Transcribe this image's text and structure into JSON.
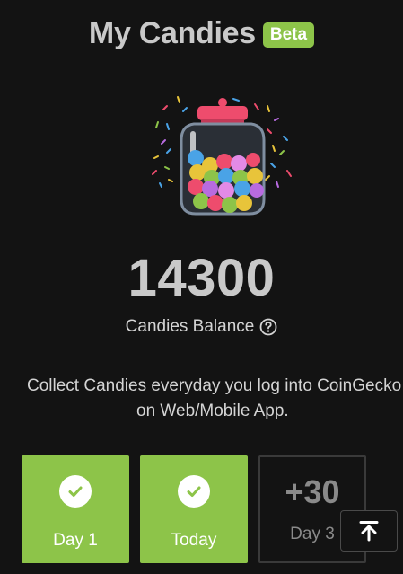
{
  "header": {
    "title": "My Candies",
    "badge": "Beta"
  },
  "balance": {
    "value": "14300",
    "label": "Candies Balance"
  },
  "description": {
    "line1": "Collect Candies everyday you log into CoinGecko",
    "line2": "on Web/Mobile App."
  },
  "days": [
    {
      "label": "Day 1",
      "status": "collected"
    },
    {
      "label": "Today",
      "status": "collected"
    },
    {
      "label": "Day 3",
      "points": "+30",
      "status": "upcoming"
    }
  ],
  "colors": {
    "accent": "#8dc449",
    "background": "#131313",
    "lid": "#ee4c6d"
  },
  "icons": {
    "help": "question-circle-icon",
    "check": "check-icon",
    "scroll_top": "arrow-up-to-line-icon",
    "jar": "candy-jar-icon"
  }
}
